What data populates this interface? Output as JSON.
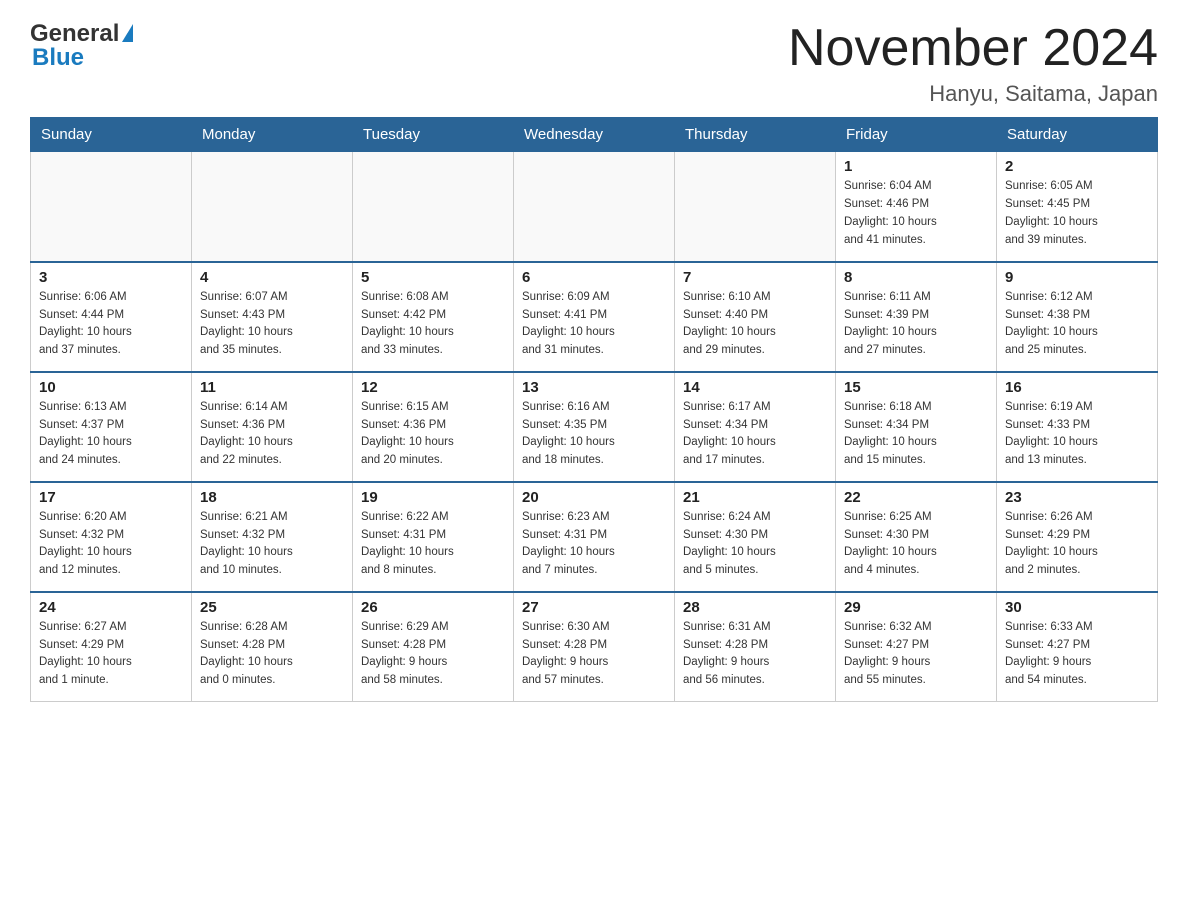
{
  "header": {
    "logo_general": "General",
    "logo_blue": "Blue",
    "month_title": "November 2024",
    "location": "Hanyu, Saitama, Japan"
  },
  "days_of_week": [
    "Sunday",
    "Monday",
    "Tuesday",
    "Wednesday",
    "Thursday",
    "Friday",
    "Saturday"
  ],
  "weeks": [
    [
      {
        "day": "",
        "info": ""
      },
      {
        "day": "",
        "info": ""
      },
      {
        "day": "",
        "info": ""
      },
      {
        "day": "",
        "info": ""
      },
      {
        "day": "",
        "info": ""
      },
      {
        "day": "1",
        "info": "Sunrise: 6:04 AM\nSunset: 4:46 PM\nDaylight: 10 hours\nand 41 minutes."
      },
      {
        "day": "2",
        "info": "Sunrise: 6:05 AM\nSunset: 4:45 PM\nDaylight: 10 hours\nand 39 minutes."
      }
    ],
    [
      {
        "day": "3",
        "info": "Sunrise: 6:06 AM\nSunset: 4:44 PM\nDaylight: 10 hours\nand 37 minutes."
      },
      {
        "day": "4",
        "info": "Sunrise: 6:07 AM\nSunset: 4:43 PM\nDaylight: 10 hours\nand 35 minutes."
      },
      {
        "day": "5",
        "info": "Sunrise: 6:08 AM\nSunset: 4:42 PM\nDaylight: 10 hours\nand 33 minutes."
      },
      {
        "day": "6",
        "info": "Sunrise: 6:09 AM\nSunset: 4:41 PM\nDaylight: 10 hours\nand 31 minutes."
      },
      {
        "day": "7",
        "info": "Sunrise: 6:10 AM\nSunset: 4:40 PM\nDaylight: 10 hours\nand 29 minutes."
      },
      {
        "day": "8",
        "info": "Sunrise: 6:11 AM\nSunset: 4:39 PM\nDaylight: 10 hours\nand 27 minutes."
      },
      {
        "day": "9",
        "info": "Sunrise: 6:12 AM\nSunset: 4:38 PM\nDaylight: 10 hours\nand 25 minutes."
      }
    ],
    [
      {
        "day": "10",
        "info": "Sunrise: 6:13 AM\nSunset: 4:37 PM\nDaylight: 10 hours\nand 24 minutes."
      },
      {
        "day": "11",
        "info": "Sunrise: 6:14 AM\nSunset: 4:36 PM\nDaylight: 10 hours\nand 22 minutes."
      },
      {
        "day": "12",
        "info": "Sunrise: 6:15 AM\nSunset: 4:36 PM\nDaylight: 10 hours\nand 20 minutes."
      },
      {
        "day": "13",
        "info": "Sunrise: 6:16 AM\nSunset: 4:35 PM\nDaylight: 10 hours\nand 18 minutes."
      },
      {
        "day": "14",
        "info": "Sunrise: 6:17 AM\nSunset: 4:34 PM\nDaylight: 10 hours\nand 17 minutes."
      },
      {
        "day": "15",
        "info": "Sunrise: 6:18 AM\nSunset: 4:34 PM\nDaylight: 10 hours\nand 15 minutes."
      },
      {
        "day": "16",
        "info": "Sunrise: 6:19 AM\nSunset: 4:33 PM\nDaylight: 10 hours\nand 13 minutes."
      }
    ],
    [
      {
        "day": "17",
        "info": "Sunrise: 6:20 AM\nSunset: 4:32 PM\nDaylight: 10 hours\nand 12 minutes."
      },
      {
        "day": "18",
        "info": "Sunrise: 6:21 AM\nSunset: 4:32 PM\nDaylight: 10 hours\nand 10 minutes."
      },
      {
        "day": "19",
        "info": "Sunrise: 6:22 AM\nSunset: 4:31 PM\nDaylight: 10 hours\nand 8 minutes."
      },
      {
        "day": "20",
        "info": "Sunrise: 6:23 AM\nSunset: 4:31 PM\nDaylight: 10 hours\nand 7 minutes."
      },
      {
        "day": "21",
        "info": "Sunrise: 6:24 AM\nSunset: 4:30 PM\nDaylight: 10 hours\nand 5 minutes."
      },
      {
        "day": "22",
        "info": "Sunrise: 6:25 AM\nSunset: 4:30 PM\nDaylight: 10 hours\nand 4 minutes."
      },
      {
        "day": "23",
        "info": "Sunrise: 6:26 AM\nSunset: 4:29 PM\nDaylight: 10 hours\nand 2 minutes."
      }
    ],
    [
      {
        "day": "24",
        "info": "Sunrise: 6:27 AM\nSunset: 4:29 PM\nDaylight: 10 hours\nand 1 minute."
      },
      {
        "day": "25",
        "info": "Sunrise: 6:28 AM\nSunset: 4:28 PM\nDaylight: 10 hours\nand 0 minutes."
      },
      {
        "day": "26",
        "info": "Sunrise: 6:29 AM\nSunset: 4:28 PM\nDaylight: 9 hours\nand 58 minutes."
      },
      {
        "day": "27",
        "info": "Sunrise: 6:30 AM\nSunset: 4:28 PM\nDaylight: 9 hours\nand 57 minutes."
      },
      {
        "day": "28",
        "info": "Sunrise: 6:31 AM\nSunset: 4:28 PM\nDaylight: 9 hours\nand 56 minutes."
      },
      {
        "day": "29",
        "info": "Sunrise: 6:32 AM\nSunset: 4:27 PM\nDaylight: 9 hours\nand 55 minutes."
      },
      {
        "day": "30",
        "info": "Sunrise: 6:33 AM\nSunset: 4:27 PM\nDaylight: 9 hours\nand 54 minutes."
      }
    ]
  ]
}
